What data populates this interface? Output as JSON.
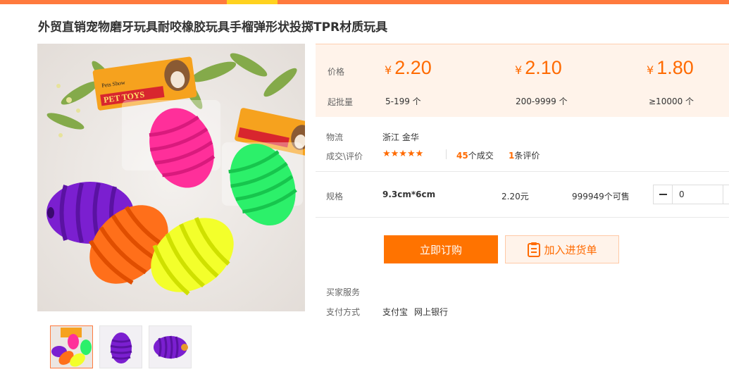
{
  "product": {
    "title": "外贸直销宠物磨牙玩具耐咬橡胶玩具手榴弹形状投掷TPR材质玩具"
  },
  "image": {
    "package_label": "PET TOYS",
    "package_brand": "Pets Show"
  },
  "pricing": {
    "price_label": "价格",
    "batch_label": "起批量",
    "currency": "¥",
    "tiers": [
      {
        "price": "2.20",
        "range": "5-199 个"
      },
      {
        "price": "2.10",
        "range": "200-9999 个"
      },
      {
        "price": "1.80",
        "range": "≥10000 个"
      }
    ]
  },
  "logistics": {
    "label": "物流",
    "value": "浙江 金华"
  },
  "reviews": {
    "label": "成交\\评价",
    "stars": "★★★★★",
    "rating": 5,
    "deals_count": "45",
    "deals_suffix": "个成交",
    "review_count": "1",
    "review_suffix": "条评价"
  },
  "spec": {
    "label": "规格",
    "name": "9.3cm*6cm",
    "price": "2.20元",
    "stock": "999949个可售",
    "quantity": "0"
  },
  "actions": {
    "order": "立即订购",
    "add_to_list": "加入进货单"
  },
  "services": {
    "buyer_label": "买家服务",
    "payment_label": "支付方式",
    "payment_methods": [
      "支付宝",
      "网上银行"
    ]
  },
  "colors": {
    "accent": "#ff7300",
    "price": "#ff6a00",
    "topbar": "#ff7a3d",
    "topbar_accent": "#ffd21f",
    "price_panel_bg": "#fff3ea"
  }
}
